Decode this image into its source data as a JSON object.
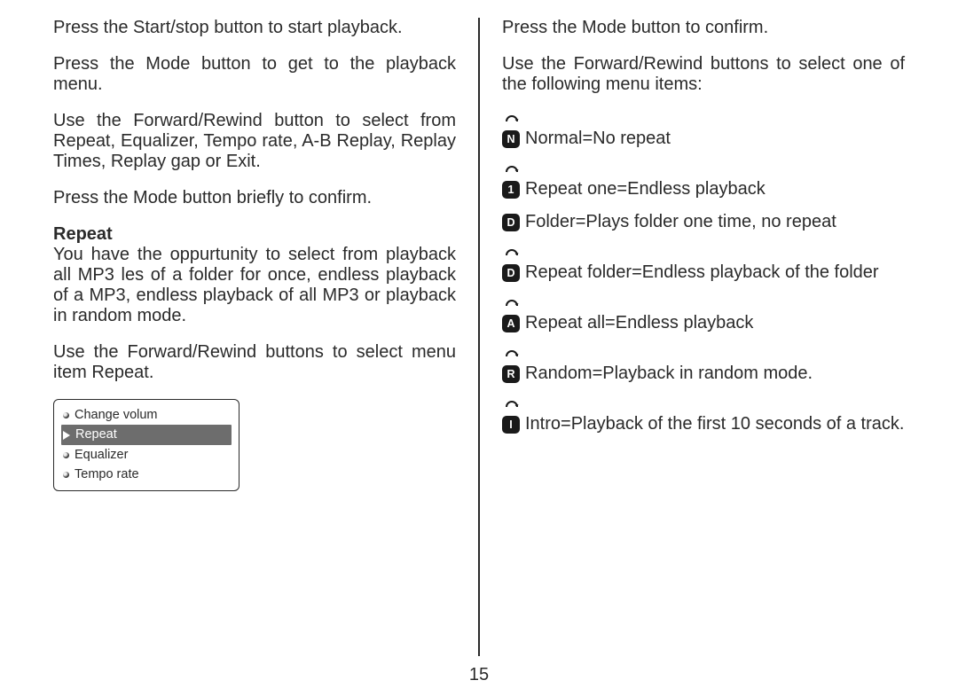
{
  "left": {
    "p1": "Press the Start/stop button to start playback.",
    "p2": "Press the Mode button to get to the playback menu.",
    "p3": "Use the Forward/Rewind button to select from Repeat, Equalizer, Tempo rate, A-B Replay, Replay Times, Replay gap or Exit.",
    "p4": "Press the Mode button briefly to confirm.",
    "repeat_heading": "Repeat",
    "p5": "You have the oppurtunity to select from playback all MP3  les of a folder for once, endless playback of a MP3, endless playback of all MP3 or playback in random mode.",
    "p6": "Use the Forward/Rewind buttons to select menu item Repeat.",
    "menu": {
      "items": [
        {
          "label": "Change volum",
          "selected": false
        },
        {
          "label": "Repeat",
          "selected": true
        },
        {
          "label": "Equalizer",
          "selected": false
        },
        {
          "label": "Tempo rate",
          "selected": false
        }
      ]
    }
  },
  "right": {
    "p1": "Press the Mode button to confirm.",
    "p2": "Use the Forward/Rewind buttons to select one of the following menu items:",
    "modes": [
      {
        "badge": "N",
        "text": "Normal=No repeat",
        "arc": true,
        "justify": false
      },
      {
        "badge": "1",
        "text": "Repeat one=Endless playback",
        "arc": true,
        "justify": false
      },
      {
        "badge": "D",
        "text": "Folder=Plays folder one time, no repeat",
        "arc": false,
        "justify": true
      },
      {
        "badge": "D",
        "text": "Repeat folder=Endless playback of the folder",
        "arc": true,
        "justify": false
      },
      {
        "badge": "A",
        "text": "Repeat all=Endless playback",
        "arc": true,
        "justify": false
      },
      {
        "badge": "R",
        "text": "Random=Playback in random mode.",
        "arc": true,
        "justify": false
      },
      {
        "badge": "I",
        "text": "Intro=Playback of the first 10 seconds of a track.",
        "arc": true,
        "justify": true
      }
    ]
  },
  "page_number": "15"
}
